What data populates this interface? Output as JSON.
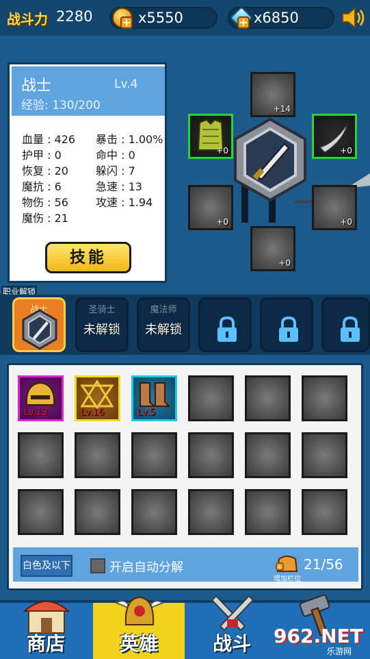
{
  "topbar": {
    "power_label": "战斗力",
    "power_value": "2280",
    "gold": "x5550",
    "gems": "x6850",
    "speaker_icon": "speaker-icon"
  },
  "hero": {
    "name": "战士",
    "level": "Lv.4",
    "exp": "经验: 130/200",
    "stats_left": [
      "血量 : 426",
      "护甲 : 0",
      "恢复 : 20",
      "魔抗 : 6",
      "物伤 : 56",
      "魔伤 : 21"
    ],
    "stats_right": [
      "暴击 : 1.00%",
      "命中 : 0",
      "躲闪 : 7",
      "急速 : 13",
      "攻速 : 1.94"
    ],
    "skill_button": "技能"
  },
  "equipment": {
    "top_count": "+14",
    "left_count": "+0",
    "right_count": "+0",
    "lower_left_count": "+0",
    "lower_right_count": "+0",
    "bottom_count": "+0"
  },
  "classes": {
    "unlock_title": "职业解锁",
    "items": [
      {
        "name": "战士",
        "state": "active"
      },
      {
        "name": "圣骑士",
        "state": "未解锁"
      },
      {
        "name": "魔法师",
        "state": "未解锁"
      },
      {
        "name": "",
        "state": "locked"
      },
      {
        "name": "",
        "state": "locked"
      },
      {
        "name": "",
        "state": "locked"
      }
    ],
    "locked_text": "未解锁"
  },
  "inventory": {
    "items": [
      {
        "lv": "Lv.13",
        "rarity": "magenta"
      },
      {
        "lv": "Lv.16",
        "rarity": "yellow"
      },
      {
        "lv": "Lv.5",
        "rarity": "cyan"
      }
    ],
    "filter_label": "白色及以下",
    "auto_label": "开启自动分解",
    "bag_count": "21/56",
    "bag_label": "增加栏位"
  },
  "nav": {
    "shop": "商店",
    "hero": "英雄",
    "battle": "战斗",
    "forge": "锻造"
  },
  "watermark": {
    "main": "962.NET",
    "sub": "乐游网"
  },
  "colors": {
    "bg": "#1b5a8a",
    "panel_head": "#5fa4de",
    "accent_yellow": "#f3d21e",
    "green_slot": "#2bd330"
  }
}
